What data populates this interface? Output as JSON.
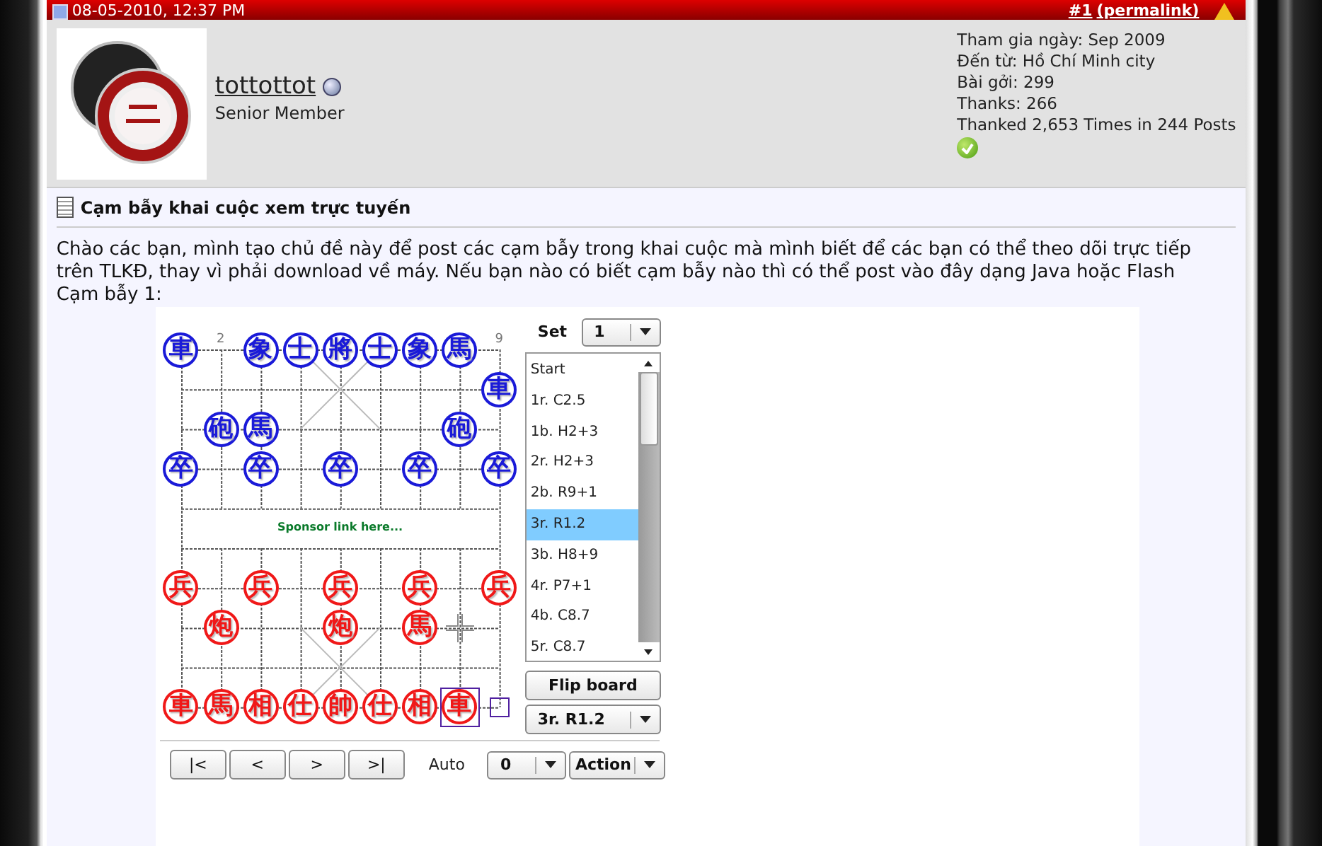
{
  "post_header": {
    "date": "08-05-2010, 12:37 PM",
    "post_number": "#1",
    "permalink": "(permalink)"
  },
  "user": {
    "name": "tottottot",
    "online": false,
    "title": "Senior Member"
  },
  "user_stats": [
    "Tham gia ngày: Sep 2009",
    "Đến từ: Hồ Chí Minh city",
    "Bài gởi: 299",
    "Thanks: 266",
    "Thanked 2,653 Times in 244 Posts"
  ],
  "post": {
    "title": "Cạm bẫy khai cuộc xem trực tuyến",
    "paragraphs": [
      "Chào các bạn, mình tạo chủ đề này để post các cạm bẫy trong khai cuộc mà mình biết để các bạn có thể theo dõi trực tiếp trên TLKĐ, thay vì phải download về máy. Nếu bạn nào có biết cạm bẫy nào thì có thể post vào đây dạng Java hoặc Flash",
      "Cạm bẫy 1:"
    ]
  },
  "board": {
    "file_labels": [
      {
        "kind": "empty"
      },
      {
        "kind": "label",
        "text": "2"
      },
      {
        "kind": "empty"
      },
      {
        "kind": "empty"
      },
      {
        "kind": "empty"
      },
      {
        "kind": "empty"
      },
      {
        "kind": "empty"
      },
      {
        "kind": "empty"
      },
      {
        "kind": "label",
        "text": "9"
      }
    ],
    "sponsor": "Sponsor link here...",
    "ranks": [
      [
        {
          "kind": "piece",
          "char": "車",
          "color": "#1a1ad8",
          "selected": false
        },
        {
          "kind": "empty"
        },
        {
          "kind": "piece",
          "char": "象",
          "color": "#1a1ad8",
          "selected": false
        },
        {
          "kind": "piece",
          "char": "士",
          "color": "#1a1ad8",
          "selected": false
        },
        {
          "kind": "piece",
          "char": "將",
          "color": "#1a1ad8",
          "selected": false
        },
        {
          "kind": "piece",
          "char": "士",
          "color": "#1a1ad8",
          "selected": false
        },
        {
          "kind": "piece",
          "char": "象",
          "color": "#1a1ad8",
          "selected": false
        },
        {
          "kind": "piece",
          "char": "馬",
          "color": "#1a1ad8",
          "selected": false
        },
        {
          "kind": "empty"
        }
      ],
      [
        {
          "kind": "empty"
        },
        {
          "kind": "empty"
        },
        {
          "kind": "empty"
        },
        {
          "kind": "empty"
        },
        {
          "kind": "empty"
        },
        {
          "kind": "empty"
        },
        {
          "kind": "empty"
        },
        {
          "kind": "empty"
        },
        {
          "kind": "piece",
          "char": "車",
          "color": "#1a1ad8",
          "selected": false
        }
      ],
      [
        {
          "kind": "empty"
        },
        {
          "kind": "piece",
          "char": "砲",
          "color": "#1a1ad8",
          "selected": false
        },
        {
          "kind": "piece",
          "char": "馬",
          "color": "#1a1ad8",
          "selected": false
        },
        {
          "kind": "empty"
        },
        {
          "kind": "empty"
        },
        {
          "kind": "empty"
        },
        {
          "kind": "empty"
        },
        {
          "kind": "piece",
          "char": "砲",
          "color": "#1a1ad8",
          "selected": false
        },
        {
          "kind": "empty"
        }
      ],
      [
        {
          "kind": "piece",
          "char": "卒",
          "color": "#1a1ad8",
          "selected": false
        },
        {
          "kind": "empty"
        },
        {
          "kind": "piece",
          "char": "卒",
          "color": "#1a1ad8",
          "selected": false
        },
        {
          "kind": "empty"
        },
        {
          "kind": "piece",
          "char": "卒",
          "color": "#1a1ad8",
          "selected": false
        },
        {
          "kind": "empty"
        },
        {
          "kind": "piece",
          "char": "卒",
          "color": "#1a1ad8",
          "selected": false
        },
        {
          "kind": "empty"
        },
        {
          "kind": "piece",
          "char": "卒",
          "color": "#1a1ad8",
          "selected": false
        }
      ],
      [
        {
          "kind": "empty"
        },
        {
          "kind": "empty"
        },
        {
          "kind": "empty"
        },
        {
          "kind": "empty"
        },
        {
          "kind": "empty"
        },
        {
          "kind": "empty"
        },
        {
          "kind": "empty"
        },
        {
          "kind": "empty"
        },
        {
          "kind": "empty"
        }
      ],
      [
        {
          "kind": "empty"
        },
        {
          "kind": "empty"
        },
        {
          "kind": "empty"
        },
        {
          "kind": "empty"
        },
        {
          "kind": "empty"
        },
        {
          "kind": "empty"
        },
        {
          "kind": "empty"
        },
        {
          "kind": "empty"
        },
        {
          "kind": "empty"
        }
      ],
      [
        {
          "kind": "piece",
          "char": "兵",
          "color": "#f01818",
          "selected": false
        },
        {
          "kind": "empty"
        },
        {
          "kind": "piece",
          "char": "兵",
          "color": "#f01818",
          "selected": false
        },
        {
          "kind": "empty"
        },
        {
          "kind": "piece",
          "char": "兵",
          "color": "#f01818",
          "selected": false
        },
        {
          "kind": "empty"
        },
        {
          "kind": "piece",
          "char": "兵",
          "color": "#f01818",
          "selected": false
        },
        {
          "kind": "empty"
        },
        {
          "kind": "piece",
          "char": "兵",
          "color": "#f01818",
          "selected": false
        }
      ],
      [
        {
          "kind": "empty"
        },
        {
          "kind": "piece",
          "char": "炮",
          "color": "#f01818",
          "selected": false
        },
        {
          "kind": "empty"
        },
        {
          "kind": "empty"
        },
        {
          "kind": "piece",
          "char": "炮",
          "color": "#f01818",
          "selected": false
        },
        {
          "kind": "empty"
        },
        {
          "kind": "piece",
          "char": "馬",
          "color": "#f01818",
          "selected": false
        },
        {
          "kind": "cursor"
        },
        {
          "kind": "empty"
        }
      ],
      [
        {
          "kind": "empty"
        },
        {
          "kind": "empty"
        },
        {
          "kind": "empty"
        },
        {
          "kind": "empty"
        },
        {
          "kind": "empty"
        },
        {
          "kind": "empty"
        },
        {
          "kind": "empty"
        },
        {
          "kind": "empty"
        },
        {
          "kind": "empty"
        }
      ],
      [
        {
          "kind": "piece",
          "char": "車",
          "color": "#f01818",
          "selected": false
        },
        {
          "kind": "piece",
          "char": "馬",
          "color": "#f01818",
          "selected": false
        },
        {
          "kind": "piece",
          "char": "相",
          "color": "#f01818",
          "selected": false
        },
        {
          "kind": "piece",
          "char": "仕",
          "color": "#f01818",
          "selected": false
        },
        {
          "kind": "piece",
          "char": "帥",
          "color": "#f01818",
          "selected": false
        },
        {
          "kind": "piece",
          "char": "仕",
          "color": "#f01818",
          "selected": false
        },
        {
          "kind": "piece",
          "char": "相",
          "color": "#f01818",
          "selected": false
        },
        {
          "kind": "piece",
          "char": "車",
          "color": "#f01818",
          "selected": true
        },
        {
          "kind": "move_from"
        }
      ]
    ]
  },
  "controls": {
    "set_label": "Set",
    "set_value": "1",
    "moves": [
      {
        "text": "Start",
        "selected": false
      },
      {
        "text": "1r. C2.5",
        "selected": false
      },
      {
        "text": "1b. H2+3",
        "selected": false
      },
      {
        "text": "2r. H2+3",
        "selected": false
      },
      {
        "text": "2b. R9+1",
        "selected": false
      },
      {
        "text": "3r. R1.2",
        "selected": true
      },
      {
        "text": "3b. H8+9",
        "selected": false
      },
      {
        "text": "4r. P7+1",
        "selected": false
      },
      {
        "text": "4b. C8.7",
        "selected": false
      },
      {
        "text": "5r. C8.7",
        "selected": false
      }
    ],
    "flip": "Flip board",
    "current_move": "3r. R1.2",
    "nav": [
      "|<",
      "<",
      ">",
      ">|"
    ],
    "auto_label": "Auto",
    "auto_value": "0",
    "action": "Action"
  }
}
